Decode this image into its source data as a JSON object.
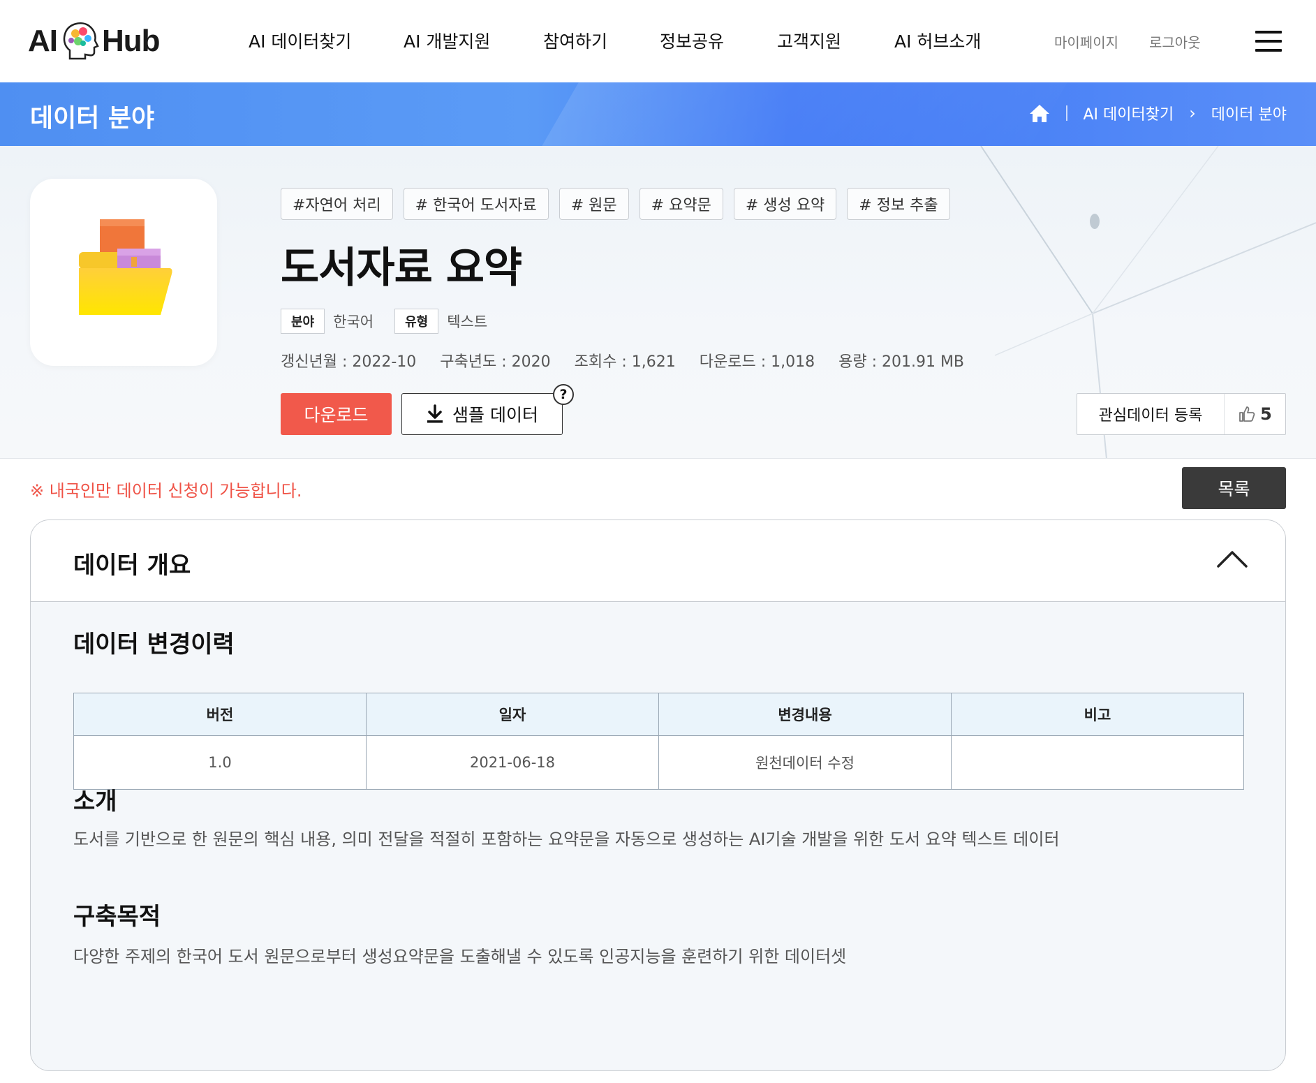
{
  "header": {
    "logo": {
      "left": "AI",
      "right": "Hub"
    },
    "nav": [
      "AI 데이터찾기",
      "AI 개발지원",
      "참여하기",
      "정보공유",
      "고객지원",
      "AI 허브소개"
    ],
    "mypage": "마이페이지",
    "logout": "로그아웃"
  },
  "band": {
    "title": "데이터 분야",
    "breadcrumb": [
      "AI 데이터찾기",
      "데이터 분야"
    ]
  },
  "dataset": {
    "tags": [
      "#자연어 처리",
      "# 한국어 도서자료",
      "# 원문",
      "# 요약문",
      "# 생성 요약",
      "# 정보 추출"
    ],
    "title": "도서자료 요약",
    "field_label": "분야",
    "field_value": "한국어",
    "type_label": "유형",
    "type_value": "텍스트",
    "stats": {
      "updated": "갱신년월 : 2022-10",
      "built": "구축년도 : 2020",
      "views": "조회수 : 1,621",
      "downloads": "다운로드 : 1,018",
      "size": "용량 : 201.91 MB"
    },
    "download_button": "다운로드",
    "sample_button": "샘플 데이터",
    "help": "?",
    "favorite_label": "관심데이터 등록",
    "like_count": "5"
  },
  "notice": "※ 내국인만 데이터 신청이 가능합니다.",
  "list_button": "목록",
  "overview": {
    "title": "데이터 개요",
    "history_title": "데이터 변경이력",
    "history_columns": [
      "버전",
      "일자",
      "변경내용",
      "비고"
    ],
    "history_rows": [
      [
        "1.0",
        "2021-06-18",
        "원천데이터 수정",
        ""
      ]
    ],
    "intro_title": "소개",
    "intro_text": "도서를 기반으로 한 원문의 핵심 내용, 의미 전달을 적절히 포함하는 요약문을 자동으로 생성하는 AI기술 개발을 위한 도서 요약 텍스트 데이터",
    "purpose_title": "구축목적",
    "purpose_text": "다양한 주제의 한국어 도서 원문으로부터 생성요약문을 도출해낼 수 있도록 인공지능을 훈련하기 위한 데이터셋"
  },
  "colors": {
    "accent_blue": "#4f8ff2",
    "download_red": "#f1594b",
    "notice_red": "#ef5246",
    "list_dark": "#3a3a3a"
  }
}
